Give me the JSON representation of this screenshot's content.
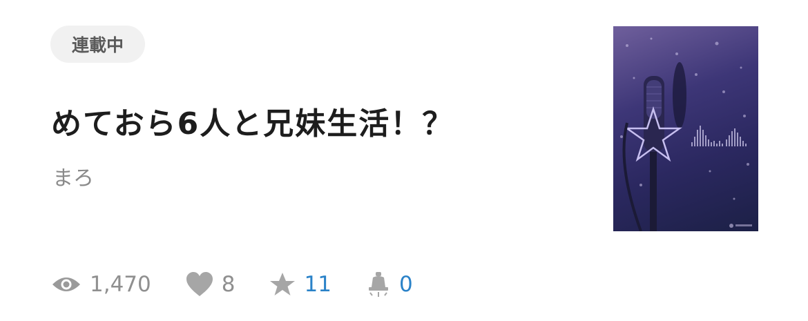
{
  "work": {
    "status_badge": "連載中",
    "title": "めておら6人と兄妹生活！？",
    "author": "まろ"
  },
  "stats": {
    "views": "1,470",
    "likes": "8",
    "stars": "11",
    "bookmarks": "0"
  },
  "colors": {
    "stat_text": "#8f8f8f",
    "stat_accent": "#2a82c8",
    "badge_bg": "#f1f1f1"
  },
  "icons": [
    "eye-icon",
    "heart-icon",
    "star-icon",
    "bell-icon"
  ]
}
